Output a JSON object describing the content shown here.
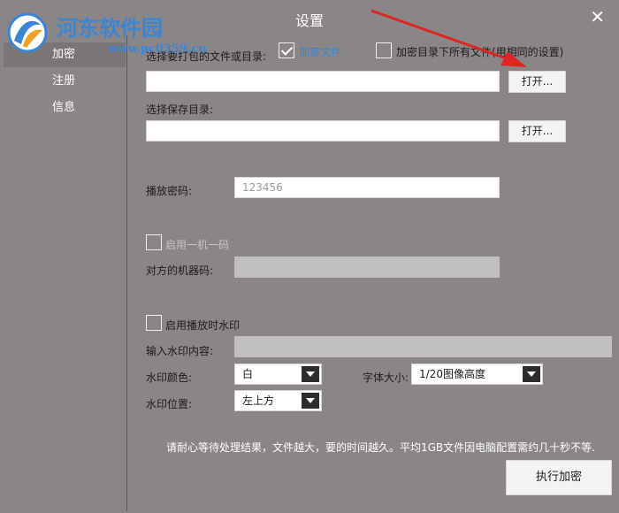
{
  "window": {
    "title": "设置",
    "close_icon": "close-icon"
  },
  "watermark": {
    "brand": "河东软件园",
    "url": "www.pc0359.cn",
    "logo_icon": "hedong-logo-icon"
  },
  "sidebar": {
    "items": [
      {
        "label": "加密",
        "active": true
      },
      {
        "label": "注册"
      },
      {
        "label": "信息"
      }
    ]
  },
  "form": {
    "source": {
      "label": "选择要打包的文件或目录:",
      "value": "",
      "button": "打开..."
    },
    "encrypt_file": {
      "label": "加密文件",
      "checked": true
    },
    "encrypt_all": {
      "label": "加密目录下所有文件(用相同的设置)",
      "checked": false
    },
    "save": {
      "label": "选择保存目录:",
      "value": "",
      "button": "打开..."
    },
    "password": {
      "label": "播放密码:",
      "value": "123456"
    },
    "one_machine": {
      "label": "启用一机一码",
      "checked": false
    },
    "machine_code": {
      "label": "对方的机器码:",
      "value": ""
    },
    "watermark_enable": {
      "label": "启用播放时水印",
      "checked": false
    },
    "watermark_text": {
      "label": "输入水印内容:",
      "value": ""
    },
    "watermark_color": {
      "label": "水印颜色:",
      "value": "白"
    },
    "font_size": {
      "label": "字体大小:",
      "value": "1/20图像高度"
    },
    "watermark_position": {
      "label": "水印位置:",
      "value": "左上方"
    }
  },
  "footer": {
    "note": "请耐心等待处理结果，文件越大，要的时间越久。平均1GB文件因电脑配置需约几十秒不等.",
    "execute_button": "执行加密"
  },
  "colors": {
    "background": "#8a8586",
    "accent": "#3a86d4",
    "arrow": "#e0241f"
  }
}
